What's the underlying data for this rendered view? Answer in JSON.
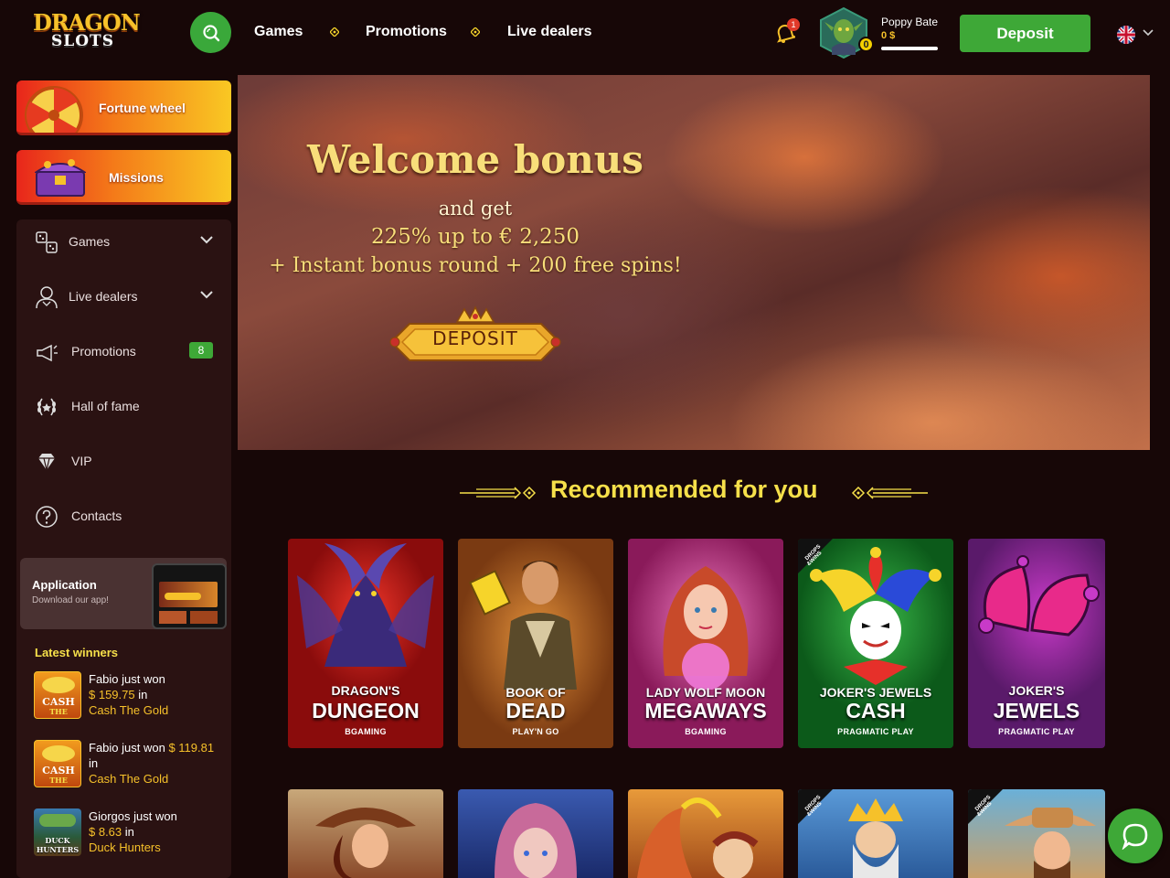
{
  "logo": {
    "line1": "DRAGON",
    "line2": "SLOTS"
  },
  "nav": {
    "games": "Games",
    "promotions": "Promotions",
    "live_dealers": "Live dealers"
  },
  "notifications": {
    "count": "1"
  },
  "user": {
    "name": "Poppy Bate",
    "balance": "0 $",
    "level": "0"
  },
  "header": {
    "deposit_label": "Deposit"
  },
  "sidebar": {
    "fortune_wheel": "Fortune wheel",
    "missions": "Missions",
    "items": [
      {
        "label": "Games",
        "icon": "games-icon"
      },
      {
        "label": "Live dealers",
        "icon": "dealer-icon"
      },
      {
        "label": "Promotions",
        "icon": "megaphone-icon",
        "badge": "8"
      },
      {
        "label": "Hall of fame",
        "icon": "laurel-icon"
      },
      {
        "label": "VIP",
        "icon": "diamond-icon"
      },
      {
        "label": "Contacts",
        "icon": "help-icon"
      }
    ],
    "app": {
      "title": "Application",
      "subtitle": "Download our app!"
    },
    "winners_title": "Latest winners",
    "winners": [
      {
        "prefix": "Fabio just won",
        "amount": "$ 159.75",
        "in": "in",
        "game": "Cash The Gold"
      },
      {
        "prefix": "Fabio just won",
        "amount": "$ 119.81",
        "in": "in",
        "game": "Cash The Gold"
      },
      {
        "prefix": "Giorgos just won",
        "amount": "$ 8.63",
        "in": "in",
        "game": "Duck Hunters"
      }
    ]
  },
  "banner": {
    "title": "Welcome bonus",
    "line1": "and get",
    "line2": "225% up to € 2,250",
    "line3": "+ Instant bonus round + 200 free spins!",
    "button": "DEPOSIT"
  },
  "recommended": {
    "title": "Recommended for you",
    "games": [
      {
        "line1": "DRAGON'S",
        "line2": "DUNGEON",
        "provider": "BGAMING",
        "color": "#c81b16"
      },
      {
        "line1": "BOOK OF",
        "line2": "DEAD",
        "provider": "PLAY'N GO",
        "color": "#b0661e"
      },
      {
        "line1": "LADY WOLF MOON",
        "line2": "MEGAWAYS",
        "provider": "BGAMING",
        "color": "#c21f7a"
      },
      {
        "line1": "JOKER'S JEWELS",
        "line2": "CASH",
        "provider": "PRAGMATIC PLAY",
        "color": "#1f8a2a"
      },
      {
        "line1": "JOKER'S",
        "line2": "JEWELS",
        "provider": "PRAGMATIC PLAY",
        "color": "#b326a8"
      }
    ]
  }
}
